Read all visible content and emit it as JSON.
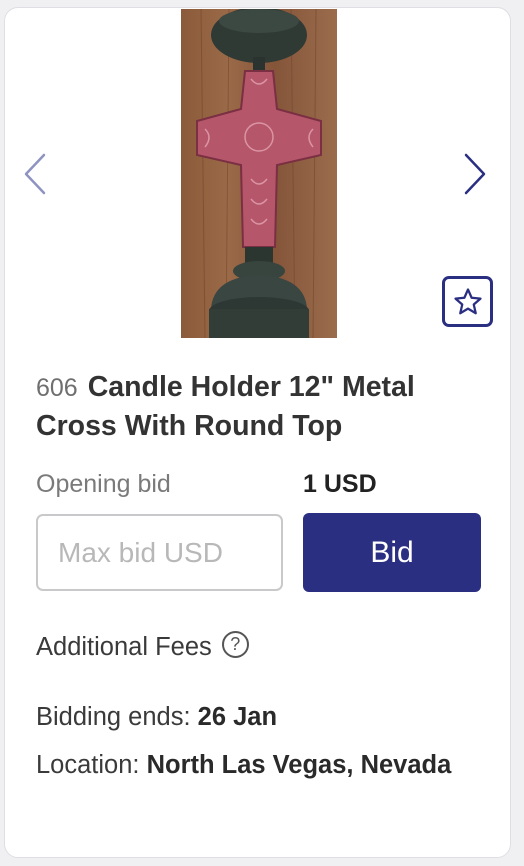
{
  "lot": {
    "number": "606",
    "title": "Candle Holder 12\" Metal Cross With Round Top"
  },
  "bidding": {
    "opening_label": "Opening bid",
    "opening_value": "1 USD",
    "max_bid_placeholder": "Max bid USD",
    "bid_button_label": "Bid"
  },
  "fees": {
    "label": "Additional Fees",
    "help_glyph": "?"
  },
  "details": {
    "ends_label": "Bidding ends:",
    "ends_value": "26 Jan",
    "location_label": "Location:",
    "location_value": "North Las Vegas, Nevada"
  },
  "icons": {
    "prev": "chevron-left-icon",
    "next": "chevron-right-icon",
    "favorite": "star-icon",
    "help": "question-circle-icon"
  },
  "colors": {
    "accent": "#2b2f82",
    "arrow_prev": "#8f93c2",
    "arrow_next": "#2b2f82"
  }
}
